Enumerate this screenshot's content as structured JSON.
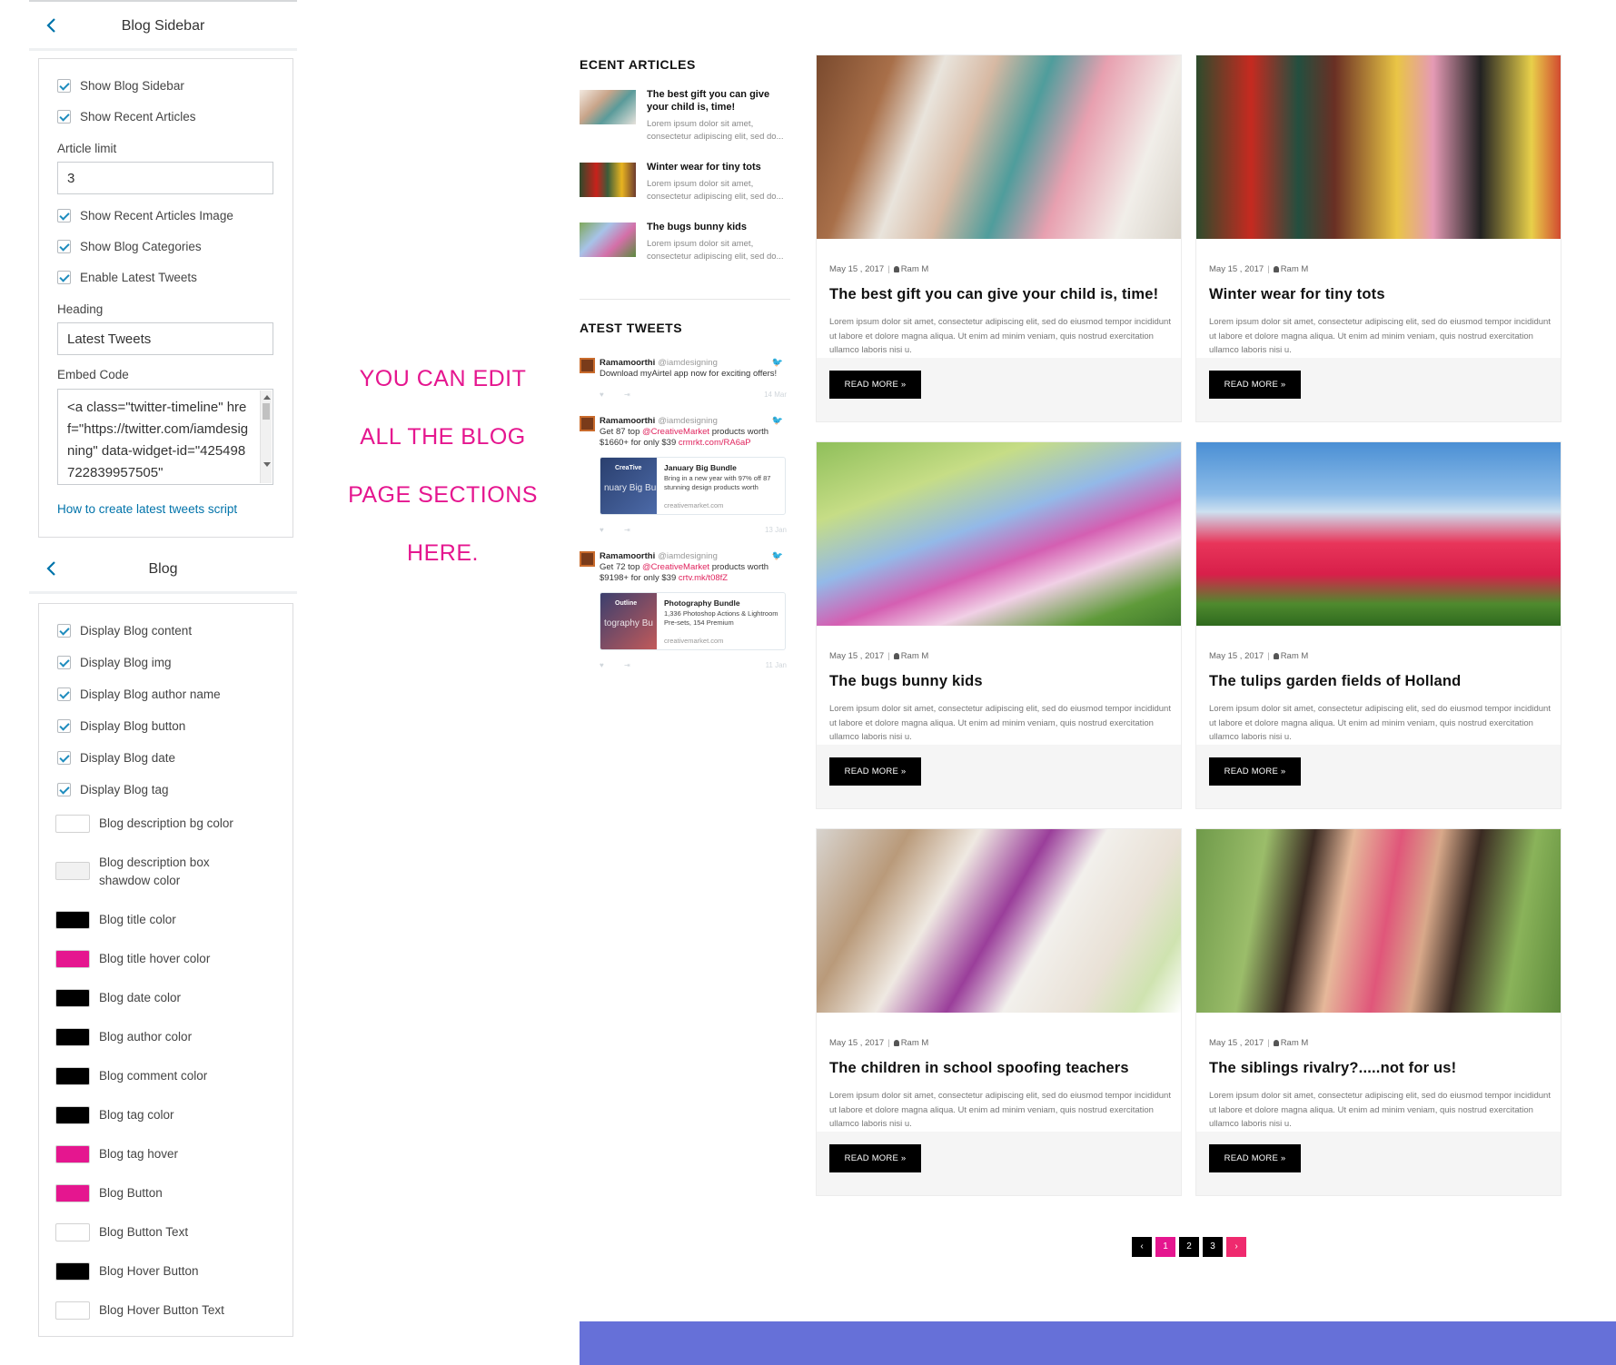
{
  "blog_sidebar_panel": {
    "title": "Blog Sidebar",
    "checkboxes": [
      {
        "label": "Show Blog Sidebar",
        "checked": true
      },
      {
        "label": "Show Recent Articles",
        "checked": true
      },
      {
        "label": "Show Recent Articles Image",
        "checked": true
      },
      {
        "label": "Show Blog Categories",
        "checked": true
      },
      {
        "label": "Enable Latest Tweets",
        "checked": true
      }
    ],
    "article_limit_label": "Article limit",
    "article_limit_value": "3",
    "heading_label": "Heading",
    "heading_value": "Latest Tweets",
    "embed_label": "Embed Code",
    "embed_value": "<a class=\"twitter-timeline\" href=\"https://twitter.com/iamdesigning\" data-widget-id=\"425498722839957505\"",
    "help_link": "How to create latest tweets script"
  },
  "blog_panel": {
    "title": "Blog",
    "checkboxes": [
      {
        "label": "Display Blog content",
        "checked": true
      },
      {
        "label": "Display Blog img",
        "checked": true
      },
      {
        "label": "Display Blog author name",
        "checked": true
      },
      {
        "label": "Display Blog button",
        "checked": true
      },
      {
        "label": "Display Blog date",
        "checked": true
      },
      {
        "label": "Display Blog tag",
        "checked": true
      }
    ],
    "colors": [
      {
        "label": "Blog description bg color",
        "value": "#ffffff"
      },
      {
        "label": "Blog description box shawdow color",
        "value": "#f1f1f1"
      },
      {
        "label": "Blog title color",
        "value": "#000000"
      },
      {
        "label": "Blog title hover color",
        "value": "#e5168f"
      },
      {
        "label": "Blog date color",
        "value": "#000000"
      },
      {
        "label": "Blog author color",
        "value": "#000000"
      },
      {
        "label": "Blog comment color",
        "value": "#000000"
      },
      {
        "label": "Blog tag color",
        "value": "#000000"
      },
      {
        "label": "Blog tag hover",
        "value": "#e5168f"
      },
      {
        "label": "Blog Button",
        "value": "#e5168f"
      },
      {
        "label": "Blog Button Text",
        "value": "#ffffff"
      },
      {
        "label": "Blog Hover Button",
        "value": "#000000"
      },
      {
        "label": "Blog Hover Button Text",
        "value": "#ffffff"
      }
    ]
  },
  "promo": {
    "lines": [
      "YOU CAN EDIT",
      "ALL THE BLOG",
      "PAGE SECTIONS",
      "HERE."
    ],
    "color": "#e5168f"
  },
  "sidebar_preview": {
    "recent_heading": "ECENT ARTICLES",
    "recent": [
      {
        "title": "The best gift you can give your child is, time!",
        "excerpt": "Lorem ipsum dolor sit amet, consectetur adipiscing elit, sed do..."
      },
      {
        "title": "Winter wear for tiny tots",
        "excerpt": "Lorem ipsum dolor sit amet, consectetur adipiscing elit, sed do..."
      },
      {
        "title": "The bugs bunny kids",
        "excerpt": "Lorem ipsum dolor sit amet, consectetur adipiscing elit, sed do..."
      }
    ],
    "tweets_heading": "ATEST TWEETS",
    "tweets": [
      {
        "name": "Ramamoorthi",
        "handle": "@iamdesigning",
        "text": "Download myAirtel app now for exciting offers!",
        "date": "14 Mar"
      },
      {
        "name": "Ramamoorthi",
        "handle": "@iamdesigning",
        "text_before": "Get 87 top ",
        "mention": "@CreativeMarket",
        "text_mid": " products worth $1660+ for only $39 ",
        "link": "crmrkt.com/RA6aP",
        "card_brand": "CreaTive",
        "card_overlay": "nuary Big Bun",
        "card_title": "January Big Bundle",
        "card_desc": "Bring in a new year with 97% off 87 stunning design products worth",
        "card_url": "creativemarket.com",
        "date": "13 Jan"
      },
      {
        "name": "Ramamoorthi",
        "handle": "@iamdesigning",
        "text_before": "Get 72 top ",
        "mention": "@CreativeMarket",
        "text_mid": " products worth $9198+ for only $39 ",
        "link": "crtv.mk/t08fZ",
        "card_brand": "Outline",
        "card_overlay": "tography Bu",
        "card_title": "Photography Bundle",
        "card_desc": "1,336 Photoshop Actions & Lightroom Pre-sets, 154 Premium",
        "card_url": "creativemarket.com",
        "date": "11 Jan"
      }
    ]
  },
  "posts": [
    {
      "date": "May 15 , 2017",
      "author": "Ram M",
      "title": "The best gift you can give your child is, time!",
      "excerpt": "Lorem ipsum dolor sit amet, consectetur adipiscing elit, sed do eiusmod tempor incididunt ut labore et dolore magna aliqua. Ut enim ad minim veniam, quis nostrud exercitation ullamco laboris nisi u.",
      "button": "READ MORE »"
    },
    {
      "date": "May 15 , 2017",
      "author": "Ram M",
      "title": "Winter wear for tiny tots",
      "excerpt": "Lorem ipsum dolor sit amet, consectetur adipiscing elit, sed do eiusmod tempor incididunt ut labore et dolore magna aliqua. Ut enim ad minim veniam, quis nostrud exercitation ullamco laboris nisi u.",
      "button": "READ MORE »"
    },
    {
      "date": "May 15 , 2017",
      "author": "Ram M",
      "title": "The bugs bunny kids",
      "excerpt": "Lorem ipsum dolor sit amet, consectetur adipiscing elit, sed do eiusmod tempor incididunt ut labore et dolore magna aliqua. Ut enim ad minim veniam, quis nostrud exercitation ullamco laboris nisi u.",
      "button": "READ MORE »"
    },
    {
      "date": "May 15 , 2017",
      "author": "Ram M",
      "title": "The tulips garden fields of Holland",
      "excerpt": "Lorem ipsum dolor sit amet, consectetur adipiscing elit, sed do eiusmod tempor incididunt ut labore et dolore magna aliqua. Ut enim ad minim veniam, quis nostrud exercitation ullamco laboris nisi u.",
      "button": "READ MORE »"
    },
    {
      "date": "May 15 , 2017",
      "author": "Ram M",
      "title": "The children in school spoofing teachers",
      "excerpt": "Lorem ipsum dolor sit amet, consectetur adipiscing elit, sed do eiusmod tempor incididunt ut labore et dolore magna aliqua. Ut enim ad minim veniam, quis nostrud exercitation ullamco laboris nisi u.",
      "button": "READ MORE »"
    },
    {
      "date": "May 15 , 2017",
      "author": "Ram M",
      "title": "The siblings rivalry?.....not for us!",
      "excerpt": "Lorem ipsum dolor sit amet, consectetur adipiscing elit, sed do eiusmod tempor incididunt ut labore et dolore magna aliqua. Ut enim ad minim veniam, quis nostrud exercitation ullamco laboris nisi u.",
      "button": "READ MORE »"
    }
  ],
  "pagination": {
    "prev": "‹",
    "pages": [
      "1",
      "2",
      "3"
    ],
    "current": "1",
    "next": "›"
  },
  "icons": {
    "back": "chevron-left-icon",
    "author": "user-icon",
    "tweet": "twitter-bird-icon"
  }
}
